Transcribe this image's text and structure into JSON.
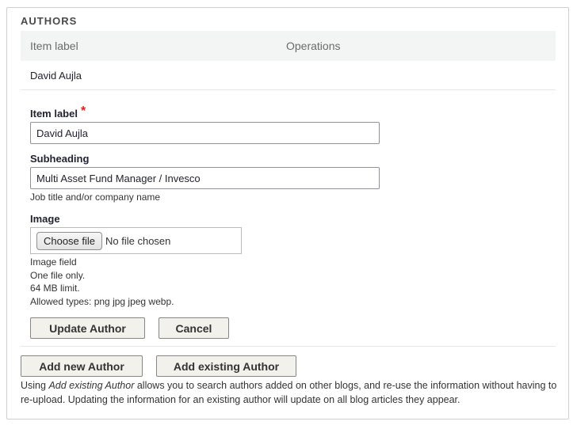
{
  "section": {
    "legend": "AUTHORS"
  },
  "table": {
    "headers": [
      "Item label",
      "Operations"
    ],
    "rows": [
      {
        "label": "David Aujla"
      }
    ]
  },
  "form": {
    "item_label": {
      "label": "Item label",
      "required_mark": "*",
      "value": "David Aujla"
    },
    "subheading": {
      "label": "Subheading",
      "value": "Multi Asset Fund Manager / Invesco",
      "description": "Job title and/or company name"
    },
    "image": {
      "label": "Image",
      "choose_button": "Choose file",
      "status": "No file chosen",
      "descriptions": [
        "Image field",
        "One file only.",
        "64 MB limit.",
        "Allowed types: png jpg jpeg webp."
      ]
    },
    "update_button": "Update Author",
    "cancel_button": "Cancel"
  },
  "actions": {
    "add_new": "Add new Author",
    "add_existing": "Add existing Author"
  },
  "help": {
    "prefix": "Using ",
    "emphasis": "Add existing Author",
    "suffix": " allows you to search authors added on other blogs, and re-use the information without having to re-upload. Updating the information for an existing author will update on all blog articles they appear."
  },
  "colors": {
    "required": "#dc2323",
    "table_header_bg": "#f3f4f4",
    "button_bg": "#f2f1eb"
  }
}
